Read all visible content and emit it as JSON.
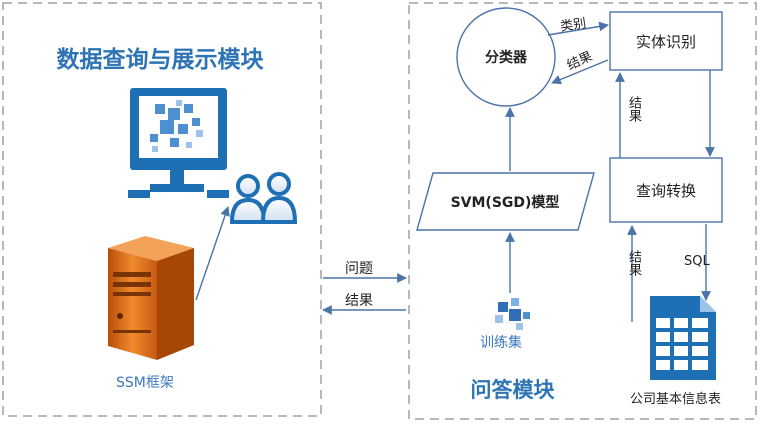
{
  "left_panel": {
    "title": "数据查询与展示模块",
    "server_label": "SSM框架"
  },
  "right_panel": {
    "title": "问答模块",
    "classifier": "分类器",
    "entity_recognition": "实体识别",
    "query_conversion": "查询转换",
    "model": "SVM(SGD)模型",
    "training_set": "训练集",
    "table_label": "公司基本信息表"
  },
  "edges": {
    "category": "类别",
    "result_classifier": "结果",
    "result_entity": "结果",
    "result_table": "结果",
    "sql": "SQL",
    "question": "问题",
    "result_bottom": "结果"
  },
  "colors": {
    "title_blue": "#2e74b5",
    "border": "#4a73a8",
    "box_fill": "#ffffff",
    "server_orange": "#e8761e",
    "monitor_blue": "#1f6fb5",
    "dashed": "#999999"
  }
}
